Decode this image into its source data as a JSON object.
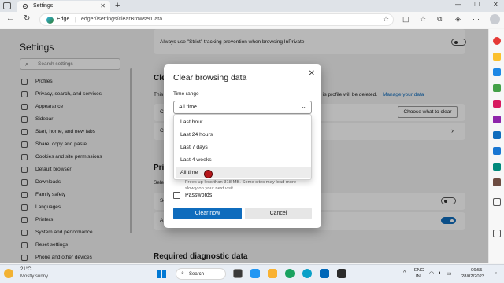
{
  "browser": {
    "tab_title": "Settings",
    "new_tab": "+",
    "address_label": "Edge",
    "address_separator": "|",
    "url": "edge://settings/clearBrowserData"
  },
  "settings_nav": {
    "title": "Settings",
    "search_placeholder": "Search settings",
    "items": [
      "Profiles",
      "Privacy, search, and services",
      "Appearance",
      "Sidebar",
      "Start, home, and new tabs",
      "Share, copy and paste",
      "Cookies and site permissions",
      "Default browser",
      "Downloads",
      "Family safety",
      "Languages",
      "Printers",
      "System and performance",
      "Reset settings",
      "Phone and other devices"
    ]
  },
  "main": {
    "strict_text": "Always use \"Strict\" tracking prevention when browsing InPrivate",
    "clear_heading_partial": "Clear",
    "this_partial": "This",
    "profile_text": "is profile will be deleted.",
    "manage_link": "Manage your data",
    "choose_button": "Choose what to clear",
    "c1": "C",
    "c2": "C",
    "priv_partial": "Priv",
    "sele_partial": "Sele",
    "se_partial": "Se",
    "a_partial": "A",
    "required_heading": "Required diagnostic data"
  },
  "dialog": {
    "title": "Clear browsing data",
    "time_range_label": "Time range",
    "selected_range": "All time",
    "options": [
      "Last hour",
      "Last 24 hours",
      "Last 7 days",
      "Last 4 weeks",
      "All time"
    ],
    "selected_index": 4,
    "note": "Frees up less than 318 MB. Some sites may load more slowly on your next visit.",
    "passwords_label": "Passwords",
    "clear_button": "Clear now",
    "cancel_button": "Cancel"
  },
  "taskbar": {
    "temperature": "21°C",
    "weather": "Mostly sunny",
    "search_label": "Search",
    "lang_top": "ENG",
    "lang_bottom": "IN",
    "time": "06:55",
    "date": "28/02/2023"
  },
  "colors": {
    "accent": "#0f6cbd",
    "cursor": "#b7161b"
  }
}
